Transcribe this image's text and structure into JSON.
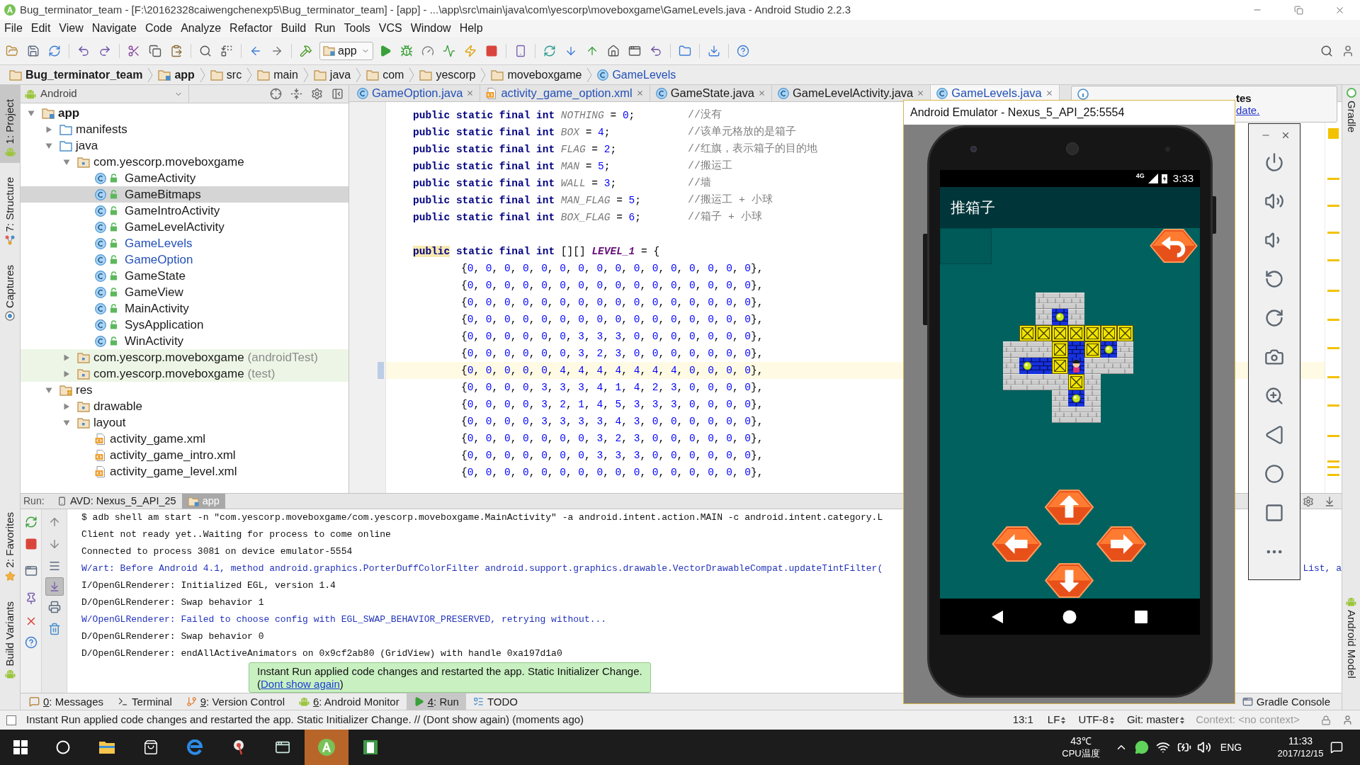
{
  "window": {
    "title": "Bug_terminator_team - [F:\\20162328caiwengchenexp5\\Bug_terminator_team] - [app] - ...\\app\\src\\main\\java\\com\\yescorp\\moveboxgame\\GameLevels.java - Android Studio 2.2.3"
  },
  "menu": [
    "File",
    "Edit",
    "View",
    "Navigate",
    "Code",
    "Analyze",
    "Refactor",
    "Build",
    "Run",
    "Tools",
    "VCS",
    "Window",
    "Help"
  ],
  "toolbar": {
    "run_config": "app"
  },
  "breadcrumbs": [
    {
      "label": "Bug_terminator_team",
      "kind": "project"
    },
    {
      "label": "app",
      "kind": "module"
    },
    {
      "label": "src",
      "kind": "folder"
    },
    {
      "label": "main",
      "kind": "folder"
    },
    {
      "label": "java",
      "kind": "folder"
    },
    {
      "label": "com",
      "kind": "folder"
    },
    {
      "label": "yescorp",
      "kind": "folder"
    },
    {
      "label": "moveboxgame",
      "kind": "folder"
    },
    {
      "label": "GameLevels",
      "kind": "class"
    }
  ],
  "left_tool_windows": {
    "top": [
      {
        "label": "1: Project",
        "kind": "project",
        "selected": true
      },
      {
        "label": "7: Structure",
        "kind": "structure",
        "selected": false
      },
      {
        "label": "Captures",
        "kind": "captures",
        "selected": false
      }
    ],
    "bottom": [
      {
        "label": "2: Favorites",
        "kind": "favorites",
        "selected": false
      },
      {
        "label": "Build Variants",
        "kind": "variants",
        "selected": false
      }
    ]
  },
  "right_tool_windows": {
    "top": [
      {
        "label": "Gradle",
        "kind": "gradle"
      }
    ],
    "bottom": [
      {
        "label": "Android Model",
        "kind": "android"
      }
    ]
  },
  "project_panel": {
    "view": "Android",
    "tree": [
      {
        "label": "app",
        "kind": "module",
        "expanded": true,
        "selected": false,
        "children": [
          {
            "label": "manifests",
            "kind": "folder",
            "expanded": false,
            "selected": false
          },
          {
            "label": "java",
            "kind": "folder",
            "expanded": true,
            "selected": false,
            "children": [
              {
                "label": "com.yescorp.moveboxgame",
                "kind": "package",
                "expanded": true,
                "selected": false,
                "children": [
                  {
                    "label": "GameActivity",
                    "kind": "class",
                    "changed": false,
                    "selected": false
                  },
                  {
                    "label": "GameBitmaps",
                    "kind": "class",
                    "changed": false,
                    "selected": true
                  },
                  {
                    "label": "GameIntroActivity",
                    "kind": "class",
                    "changed": false,
                    "selected": false
                  },
                  {
                    "label": "GameLevelActivity",
                    "kind": "class",
                    "changed": false,
                    "selected": false
                  },
                  {
                    "label": "GameLevels",
                    "kind": "class",
                    "changed": true,
                    "selected": false
                  },
                  {
                    "label": "GameOption",
                    "kind": "class",
                    "changed": true,
                    "selected": false
                  },
                  {
                    "label": "GameState",
                    "kind": "class",
                    "changed": false,
                    "selected": false
                  },
                  {
                    "label": "GameView",
                    "kind": "class",
                    "changed": false,
                    "selected": false
                  },
                  {
                    "label": "MainActivity",
                    "kind": "class",
                    "changed": false,
                    "selected": false
                  },
                  {
                    "label": "SysApplication",
                    "kind": "class",
                    "changed": false,
                    "selected": false
                  },
                  {
                    "label": "WinActivity",
                    "kind": "class",
                    "changed": false,
                    "selected": false
                  }
                ]
              },
              {
                "label": "com.yescorp.moveboxgame",
                "suffix": "(androidTest)",
                "kind": "test_package",
                "expanded": false,
                "selected": false
              },
              {
                "label": "com.yescorp.moveboxgame",
                "suffix": "(test)",
                "kind": "test_package",
                "expanded": false,
                "selected": false
              }
            ]
          },
          {
            "label": "res",
            "kind": "res_folder",
            "expanded": true,
            "selected": false,
            "children": [
              {
                "label": "drawable",
                "kind": "package",
                "expanded": false,
                "selected": false
              },
              {
                "label": "layout",
                "kind": "package",
                "expanded": true,
                "selected": false,
                "children": [
                  {
                    "label": "activity_game.xml",
                    "kind": "xml",
                    "selected": false
                  },
                  {
                    "label": "activity_game_intro.xml",
                    "kind": "xml",
                    "selected": false
                  },
                  {
                    "label": "activity_game_level.xml",
                    "kind": "xml",
                    "selected": false
                  }
                ]
              }
            ]
          }
        ]
      }
    ]
  },
  "editor": {
    "tabs": [
      {
        "label": "GameOption.java",
        "kind": "class",
        "changed": true,
        "selected": false
      },
      {
        "label": "activity_game_option.xml",
        "kind": "xml",
        "changed": true,
        "selected": false
      },
      {
        "label": "GameState.java",
        "kind": "class",
        "changed": false,
        "selected": false
      },
      {
        "label": "GameLevelActivity.java",
        "kind": "class",
        "changed": false,
        "selected": false
      },
      {
        "label": "GameLevels.java",
        "kind": "class",
        "changed": true,
        "selected": true
      }
    ],
    "lines": [
      {
        "kind": "declaration",
        "tokens": [
          {
            "text": "public static final int ",
            "kind": "keyword"
          },
          {
            "text": "NOTHING",
            "kind": "unused_field"
          },
          {
            "text": " = ",
            "kind": "plain"
          },
          {
            "text": "0",
            "kind": "number"
          },
          {
            "text": ";",
            "kind": "plain"
          }
        ],
        "comment": "//没有",
        "current": false,
        "changed": false
      },
      {
        "kind": "declaration",
        "tokens": [
          {
            "text": "public static final int ",
            "kind": "keyword"
          },
          {
            "text": "BOX",
            "kind": "unused_field"
          },
          {
            "text": " = ",
            "kind": "plain"
          },
          {
            "text": "4",
            "kind": "number"
          },
          {
            "text": ";",
            "kind": "plain"
          }
        ],
        "comment": "//该单元格放的是箱子",
        "current": false,
        "changed": false
      },
      {
        "kind": "declaration",
        "tokens": [
          {
            "text": "public static final int ",
            "kind": "keyword"
          },
          {
            "text": "FLAG",
            "kind": "unused_field"
          },
          {
            "text": " = ",
            "kind": "plain"
          },
          {
            "text": "2",
            "kind": "number"
          },
          {
            "text": ";",
            "kind": "plain"
          }
        ],
        "comment": "//红旗，表示箱子的目的地",
        "current": false,
        "changed": false
      },
      {
        "kind": "declaration",
        "tokens": [
          {
            "text": "public static final int ",
            "kind": "keyword"
          },
          {
            "text": "MAN",
            "kind": "unused_field"
          },
          {
            "text": " = ",
            "kind": "plain"
          },
          {
            "text": "5",
            "kind": "number"
          },
          {
            "text": ";",
            "kind": "plain"
          }
        ],
        "comment": "//搬运工",
        "current": false,
        "changed": false
      },
      {
        "kind": "declaration",
        "tokens": [
          {
            "text": "public static final int ",
            "kind": "keyword"
          },
          {
            "text": "WALL",
            "kind": "unused_field"
          },
          {
            "text": " = ",
            "kind": "plain"
          },
          {
            "text": "3",
            "kind": "number"
          },
          {
            "text": ";",
            "kind": "plain"
          }
        ],
        "comment": "//墙",
        "current": false,
        "changed": false
      },
      {
        "kind": "declaration",
        "tokens": [
          {
            "text": "public static final int ",
            "kind": "keyword"
          },
          {
            "text": "MAN_FLAG",
            "kind": "unused_field"
          },
          {
            "text": " = ",
            "kind": "plain"
          },
          {
            "text": "5",
            "kind": "number"
          },
          {
            "text": ";",
            "kind": "plain"
          }
        ],
        "comment": "//搬运工 + 小球",
        "current": false,
        "changed": false
      },
      {
        "kind": "declaration",
        "tokens": [
          {
            "text": "public static final int ",
            "kind": "keyword"
          },
          {
            "text": "BOX_FLAG",
            "kind": "unused_field"
          },
          {
            "text": " = ",
            "kind": "plain"
          },
          {
            "text": "6",
            "kind": "number"
          },
          {
            "text": ";",
            "kind": "plain"
          }
        ],
        "comment": "//箱子 + 小球",
        "current": false,
        "changed": false
      },
      {
        "kind": "blank"
      },
      {
        "kind": "declaration",
        "tokens": [
          {
            "text": "public",
            "kind": "keyword_marked"
          },
          {
            "text": " static final int ",
            "kind": "keyword"
          },
          {
            "text": "[][] ",
            "kind": "plain"
          },
          {
            "text": "LEVEL_1",
            "kind": "field"
          },
          {
            "text": " = {",
            "kind": "plain"
          }
        ],
        "current": false,
        "changed": false
      },
      {
        "kind": "array_row",
        "text": "{0, 0, 0, 0, 0, 0, 0, 0, 0, 0, 0, 0, 0, 0, 0, 0},",
        "current": false,
        "changed": false
      },
      {
        "kind": "array_row",
        "text": "{0, 0, 0, 0, 0, 0, 0, 0, 0, 0, 0, 0, 0, 0, 0, 0},",
        "current": false,
        "changed": false
      },
      {
        "kind": "array_row",
        "text": "{0, 0, 0, 0, 0, 0, 0, 0, 0, 0, 0, 0, 0, 0, 0, 0},",
        "current": false,
        "changed": false
      },
      {
        "kind": "array_row",
        "text": "{0, 0, 0, 0, 0, 0, 0, 0, 0, 0, 0, 0, 0, 0, 0, 0},",
        "current": false,
        "changed": false
      },
      {
        "kind": "array_row",
        "text": "{0, 0, 0, 0, 0, 0, 3, 3, 3, 0, 0, 0, 0, 0, 0, 0},",
        "current": false,
        "changed": false
      },
      {
        "kind": "array_row",
        "text": "{0, 0, 0, 0, 0, 0, 3, 2, 3, 0, 0, 0, 0, 0, 0, 0},",
        "current": false,
        "changed": false
      },
      {
        "kind": "array_row",
        "text": "{0, 0, 0, 0, 0, 4, 4, 4, 4, 4, 4, 4, 0, 0, 0, 0},",
        "current": true,
        "changed": true
      },
      {
        "kind": "array_row",
        "text": "{0, 0, 0, 0, 3, 3, 3, 4, 1, 4, 2, 3, 0, 0, 0, 0},",
        "current": false,
        "changed": false
      },
      {
        "kind": "array_row",
        "text": "{0, 0, 0, 0, 3, 2, 1, 4, 5, 3, 3, 3, 0, 0, 0, 0},",
        "current": false,
        "changed": false
      },
      {
        "kind": "array_row",
        "text": "{0, 0, 0, 0, 3, 3, 3, 3, 4, 3, 0, 0, 0, 0, 0, 0},",
        "current": false,
        "changed": false
      },
      {
        "kind": "array_row",
        "text": "{0, 0, 0, 0, 0, 0, 0, 3, 2, 3, 0, 0, 0, 0, 0, 0},",
        "current": false,
        "changed": false
      },
      {
        "kind": "array_row",
        "text": "{0, 0, 0, 0, 0, 0, 0, 3, 3, 3, 0, 0, 0, 0, 0, 0},",
        "current": false,
        "changed": false
      },
      {
        "kind": "array_row",
        "text": "{0, 0, 0, 0, 0, 0, 0, 0, 0, 0, 0, 0, 0, 0, 0, 0},",
        "current": false,
        "changed": false
      }
    ]
  },
  "updates_balloon": {
    "title": "tes",
    "link": "date."
  },
  "run_panel": {
    "label": "Run:",
    "tabs": [
      {
        "label": "AVD: Nexus_5_API_25",
        "kind": "device",
        "selected": false
      },
      {
        "label": "app",
        "kind": "app",
        "selected": true
      }
    ],
    "autoscroll": true,
    "lines": [
      {
        "text": "$ adb shell am start -n \"com.yescorp.moveboxgame/com.yescorp.moveboxgame.MainActivity\" -a android.intent.action.MAIN -c android.intent.category.L",
        "kind": "info"
      },
      {
        "text": "Client not ready yet..Waiting for process to come online",
        "kind": "info"
      },
      {
        "text": "Connected to process 3081 on device emulator-5554",
        "kind": "info"
      },
      {
        "text": "W/art: Before Android 4.1, method android.graphics.PorterDuffColorFilter android.support.graphics.drawable.VectorDrawableCompat.updateTintFilter(",
        "kind": "warning",
        "tail": "List, a"
      },
      {
        "text": "I/OpenGLRenderer: Initialized EGL, version 1.4",
        "kind": "info"
      },
      {
        "text": "D/OpenGLRenderer: Swap behavior 1",
        "kind": "info"
      },
      {
        "text": "W/OpenGLRenderer: Failed to choose config with EGL_SWAP_BEHAVIOR_PRESERVED, retrying without...",
        "kind": "warning"
      },
      {
        "text": "D/OpenGLRenderer: Swap behavior 0",
        "kind": "info"
      },
      {
        "text": "D/OpenGLRenderer: endAllActiveAnimators on 0x9cf2ab80 (GridView) with handle 0xa197d1a0",
        "kind": "info"
      }
    ]
  },
  "notification": {
    "message": "Instant Run applied code changes and restarted the app. Static Initializer Change.",
    "link_open": "(",
    "link": "Dont show again",
    "link_close": ")"
  },
  "bottom_tool_windows": [
    {
      "mnemonic": "0",
      "label": ": Messages",
      "kind": "messages",
      "selected": false
    },
    {
      "label": "Terminal",
      "kind": "terminal",
      "selected": false
    },
    {
      "mnemonic": "9",
      "label": ": Version Control",
      "kind": "vcs",
      "selected": false
    },
    {
      "mnemonic": "6",
      "label": ": Android Monitor",
      "kind": "android",
      "selected": false
    },
    {
      "mnemonic": "4",
      "label": ": Run",
      "kind": "run",
      "selected": true
    },
    {
      "label": "TODO",
      "kind": "todo",
      "selected": false
    }
  ],
  "bottom_right_tool_windows": [
    {
      "label": "Gradle Console",
      "kind": "console",
      "selected": false
    }
  ],
  "emulator": {
    "title": "Android Emulator - Nexus_5_API_25:5554",
    "network": "4G",
    "time": "3:33",
    "app_title": "推箱子",
    "board": [
      [
        {
          "kind": "empty"
        },
        {
          "kind": "empty"
        },
        {
          "kind": "wall"
        },
        {
          "kind": "wall"
        },
        {
          "kind": "wall"
        },
        {
          "kind": "empty"
        },
        {
          "kind": "empty"
        },
        {
          "kind": "empty"
        }
      ],
      [
        {
          "kind": "empty"
        },
        {
          "kind": "empty"
        },
        {
          "kind": "wall"
        },
        {
          "kind": "goal"
        },
        {
          "kind": "wall"
        },
        {
          "kind": "empty"
        },
        {
          "kind": "empty"
        },
        {
          "kind": "empty"
        }
      ],
      [
        {
          "kind": "empty"
        },
        {
          "kind": "box"
        },
        {
          "kind": "box"
        },
        {
          "kind": "box"
        },
        {
          "kind": "box"
        },
        {
          "kind": "box"
        },
        {
          "kind": "box"
        },
        {
          "kind": "box"
        }
      ],
      [
        {
          "kind": "wall"
        },
        {
          "kind": "wall"
        },
        {
          "kind": "wall"
        },
        {
          "kind": "box"
        },
        {
          "kind": "floor"
        },
        {
          "kind": "box"
        },
        {
          "kind": "goal"
        },
        {
          "kind": "wall"
        }
      ],
      [
        {
          "kind": "wall"
        },
        {
          "kind": "goal"
        },
        {
          "kind": "floor"
        },
        {
          "kind": "box"
        },
        {
          "kind": "player"
        },
        {
          "kind": "wall"
        },
        {
          "kind": "wall"
        },
        {
          "kind": "wall"
        }
      ],
      [
        {
          "kind": "wall"
        },
        {
          "kind": "wall"
        },
        {
          "kind": "wall"
        },
        {
          "kind": "wall"
        },
        {
          "kind": "box"
        },
        {
          "kind": "wall"
        },
        {
          "kind": "empty"
        },
        {
          "kind": "empty"
        }
      ],
      [
        {
          "kind": "empty"
        },
        {
          "kind": "empty"
        },
        {
          "kind": "empty"
        },
        {
          "kind": "wall"
        },
        {
          "kind": "goal"
        },
        {
          "kind": "wall"
        },
        {
          "kind": "empty"
        },
        {
          "kind": "empty"
        }
      ],
      [
        {
          "kind": "empty"
        },
        {
          "kind": "empty"
        },
        {
          "kind": "empty"
        },
        {
          "kind": "wall"
        },
        {
          "kind": "wall"
        },
        {
          "kind": "wall"
        },
        {
          "kind": "empty"
        },
        {
          "kind": "empty"
        }
      ]
    ]
  },
  "status_bar": {
    "message": "Instant Run applied code changes and restarted the app. Static Initializer Change. // (Dont show again) (moments ago)",
    "position": "13:1",
    "line_separator": "LF",
    "encoding": "UTF-8",
    "vcs_branch": "Git: master",
    "context": "Context: <no context>"
  },
  "taskbar": {
    "apps": [
      {
        "kind": "search",
        "selected": false
      },
      {
        "kind": "explorer",
        "selected": false
      },
      {
        "kind": "store",
        "selected": false
      },
      {
        "kind": "browser",
        "selected": false
      },
      {
        "kind": "tool",
        "selected": false
      },
      {
        "kind": "window",
        "selected": false
      },
      {
        "kind": "studio",
        "selected": true
      },
      {
        "kind": "notes",
        "selected": false
      }
    ],
    "temperature": "43℃",
    "temperature_label": "CPU温度",
    "language": "ENG",
    "time": "11:33",
    "date": "2017/12/15"
  }
}
